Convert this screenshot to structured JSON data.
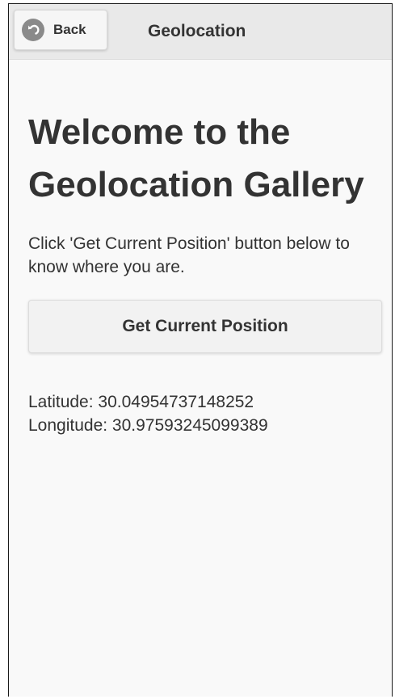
{
  "header": {
    "back_label": "Back",
    "title": "Geolocation"
  },
  "main": {
    "title": "Welcome to the Geolocation Gallery",
    "instructions": "Click 'Get Current Position' button below to know where you are.",
    "button_label": "Get Current Position",
    "latitude": "Latitude: 30.04954737148252",
    "longitude": "Longitude: 30.97593245099389"
  },
  "icons": {
    "back": "back-arrow-circle-icon"
  }
}
